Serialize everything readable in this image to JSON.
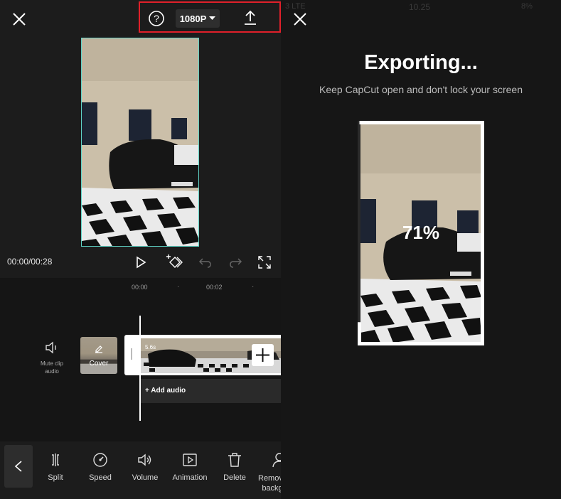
{
  "editor": {
    "top_bar": {
      "close_icon": "close-icon",
      "help_icon": "help-icon",
      "resolution_label": "1080P",
      "export_icon": "upload-icon"
    },
    "player": {
      "time_display": "00:00/00:28"
    },
    "ruler": {
      "ticks": [
        "00:00",
        "00:02"
      ]
    },
    "timeline": {
      "mute_label": "Mute clip audio",
      "cover_label": "Cover",
      "clip_duration": "5.6s",
      "add_audio_label": "+ Add audio"
    },
    "toolbar": {
      "items": [
        {
          "label": "Split",
          "icon": "split-icon"
        },
        {
          "label": "Speed",
          "icon": "speed-icon"
        },
        {
          "label": "Volume",
          "icon": "volume-icon"
        },
        {
          "label": "Animation",
          "icon": "animation-icon"
        },
        {
          "label": "Delete",
          "icon": "trash-icon"
        },
        {
          "label": "Remove backg",
          "icon": "person-icon"
        }
      ]
    }
  },
  "export": {
    "status": {
      "carrier": "3  LTE",
      "time": "10.25",
      "battery": "8%"
    },
    "title": "Exporting...",
    "subtitle": "Keep CapCut open and don't lock your screen",
    "progress_label": "71%",
    "progress": 0.71
  },
  "colors": {
    "accent": "#5fd3c6",
    "highlight_border": "#e0202a"
  }
}
